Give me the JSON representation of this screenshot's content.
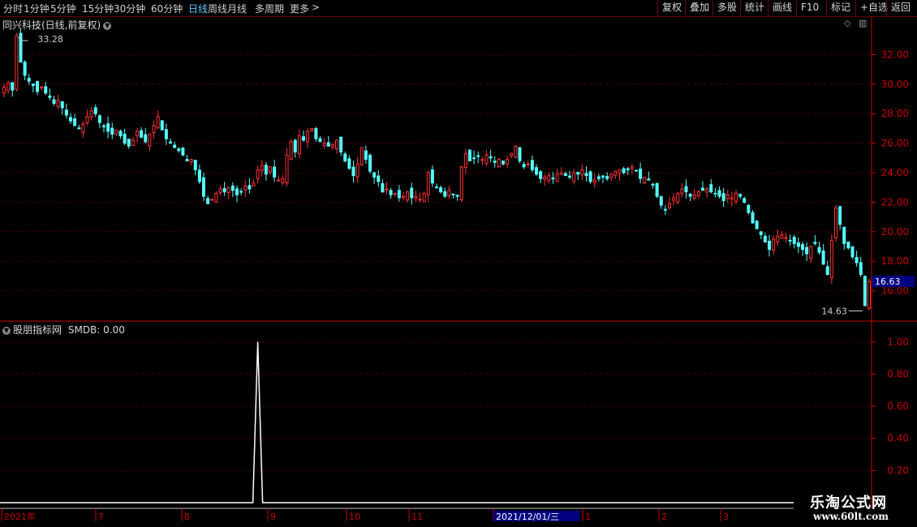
{
  "toolbar": {
    "left_items": [
      {
        "label": "分时",
        "active": false
      },
      {
        "label": "1分钟",
        "active": false
      },
      {
        "label": "5分钟",
        "active": false
      },
      {
        "label": "15分钟",
        "active": false
      },
      {
        "label": "30分钟",
        "active": false
      },
      {
        "label": "60分钟",
        "active": false
      },
      {
        "label": "日线",
        "active": true
      },
      {
        "label": "周线",
        "active": false
      },
      {
        "label": "月线",
        "active": false
      },
      {
        "label": "多周期",
        "active": false
      },
      {
        "label": "更多",
        "active": false
      }
    ],
    "more_arrow": ">",
    "right_buttons": [
      "复权",
      "叠加",
      "多股",
      "统计",
      "画线",
      "F10",
      "标记",
      "+自选",
      "返回"
    ]
  },
  "price_pane": {
    "title": "同兴科技(日线,前复权)",
    "high_label": "33.28",
    "low_label": "14.63",
    "current_price": "16.63",
    "y_ticks": [
      "32.00",
      "30.00",
      "28.00",
      "26.00",
      "24.00",
      "22.00",
      "20.00",
      "18.00",
      "16.00"
    ]
  },
  "indicator_pane": {
    "title": "股朋指标网",
    "indicator_name": "SMDB:",
    "indicator_value": "0.00",
    "y_ticks": [
      "1.00",
      "0.80",
      "0.60",
      "0.40",
      "0.20"
    ]
  },
  "x_axis": {
    "labels": [
      "2021年",
      "7",
      "8",
      "9",
      "10",
      "11",
      "2021/12/01/三",
      "1",
      "2",
      "3"
    ]
  },
  "watermark": {
    "title": "乐淘公式网",
    "url": "www.60lt.com"
  },
  "colors": {
    "up": "#ff3232",
    "down": "#54ffff",
    "grid": "#8b0000",
    "axis": "#c80000",
    "indicator": "#ffffff",
    "current_price_bg": "#000080",
    "date_highlight_bg": "#000080"
  },
  "chart_data": {
    "type": "candlestick",
    "indicator_type": "line",
    "price_ylim": [
      14,
      34
    ],
    "indicator_ylim": [
      0,
      1.1
    ],
    "closes": [
      29.8,
      30.1,
      29.6,
      33.28,
      31.5,
      30.6,
      30.2,
      29.9,
      29.5,
      29.8,
      29.4,
      29.1,
      28.7,
      28.9,
      28.4,
      27.9,
      27.5,
      27.2,
      27.0,
      27.3,
      27.8,
      28.2,
      28.0,
      27.4,
      27.1,
      26.8,
      26.6,
      26.9,
      26.5,
      26.0,
      25.8,
      26.2,
      26.8,
      26.4,
      26.1,
      26.6,
      27.2,
      27.8,
      26.9,
      26.3,
      26.0,
      25.7,
      25.5,
      25.2,
      24.8,
      24.9,
      24.2,
      23.4,
      22.4,
      21.9,
      22.2,
      22.6,
      22.9,
      22.7,
      23.0,
      22.8,
      22.5,
      22.7,
      23.1,
      22.9,
      23.3,
      24.2,
      24.5,
      23.9,
      24.4,
      23.7,
      23.5,
      23.6,
      25.2,
      26.1,
      25.4,
      26.5,
      26.2,
      26.8,
      27.0,
      26.3,
      26.1,
      26.0,
      25.8,
      25.9,
      26.2,
      25.4,
      24.8,
      24.3,
      23.8,
      24.6,
      25.7,
      24.9,
      24.1,
      23.7,
      23.4,
      22.7,
      22.9,
      22.5,
      22.6,
      22.3,
      22.4,
      22.7,
      22.3,
      22.4,
      22.2,
      22.6,
      24.0,
      23.3,
      23.0,
      22.7,
      22.4,
      22.8,
      22.5,
      22.4,
      24.4,
      25.3,
      24.8,
      25.0,
      25.1,
      24.9,
      25.2,
      25.0,
      24.7,
      24.9,
      24.6,
      24.9,
      25.3,
      25.8,
      24.8,
      24.4,
      24.6,
      24.2,
      23.9,
      23.6,
      23.7,
      23.8,
      23.6,
      23.9,
      24.0,
      23.8,
      23.7,
      24.0,
      23.9,
      24.2,
      23.8,
      23.4,
      23.5,
      23.6,
      23.7,
      23.6,
      23.9,
      24.1,
      24.2,
      24.0,
      24.2,
      24.4,
      24.1,
      23.6,
      23.7,
      23.5,
      23.2,
      22.4,
      21.8,
      21.5,
      21.9,
      22.3,
      22.6,
      22.9,
      22.7,
      22.4,
      22.5,
      22.7,
      22.8,
      22.9,
      22.7,
      22.6,
      22.4,
      22.1,
      22.5,
      22.3,
      22.6,
      22.4,
      22.0,
      21.3,
      20.6,
      20.2,
      19.8,
      19.3,
      18.8,
      19.5,
      19.7,
      19.8,
      19.6,
      19.4,
      19.2,
      19.0,
      18.8,
      18.5,
      19.0,
      19.2,
      18.6,
      17.8,
      17.1,
      19.4,
      21.6,
      20.5,
      19.2,
      18.9,
      18.3,
      17.9,
      17.1,
      15.0,
      16.63
    ]
  }
}
